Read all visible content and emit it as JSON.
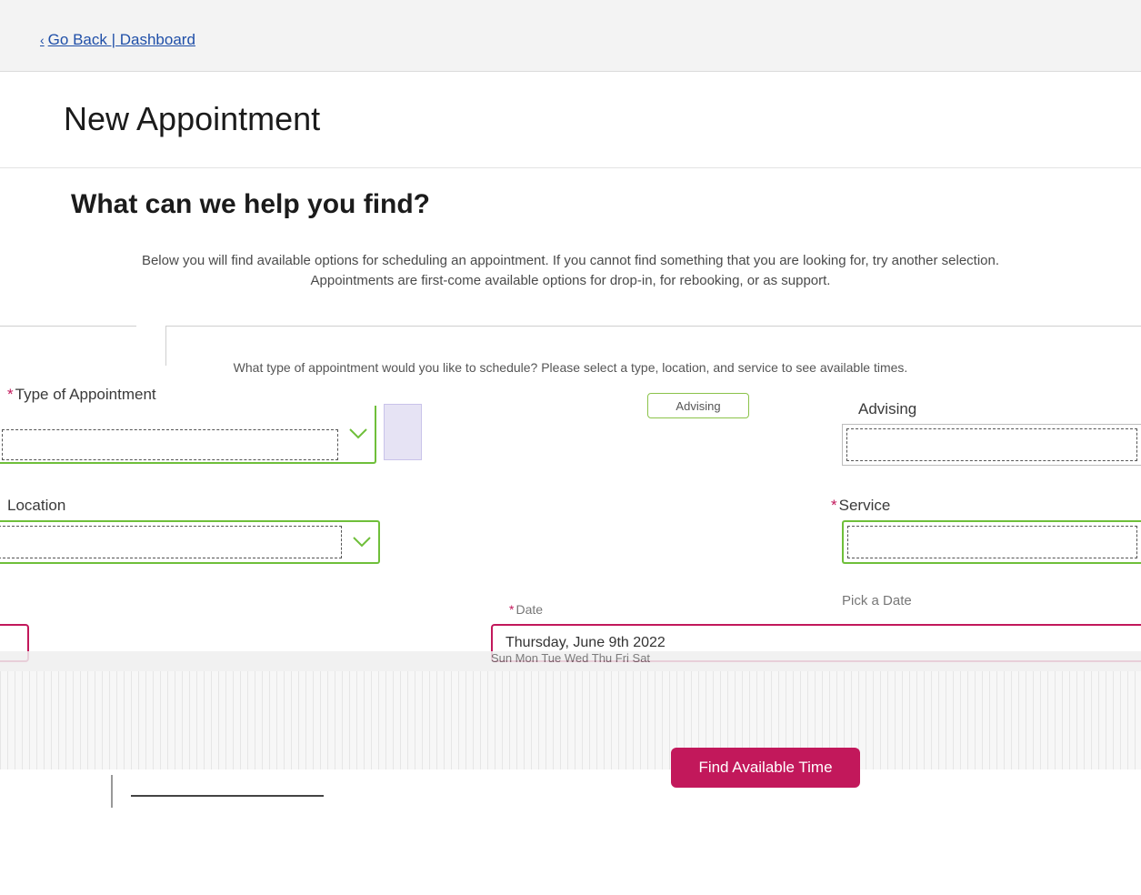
{
  "nav": {
    "back_link": "Go Back | Dashboard"
  },
  "page": {
    "title": "New Appointment"
  },
  "section": {
    "title": "What can we help you find?",
    "intro_line1": "Below you will find available options for scheduling an appointment. If you cannot find something that you are looking for, try another selection.",
    "intro_line2": "Appointments are first-come available options for drop-in, for rebooking, or as support."
  },
  "form": {
    "card_intro": "What type of appointment would you like to schedule? Please select a type, location, and service to see available times.",
    "chip_label": "Advising",
    "type_select": {
      "label": "Type of Appointment",
      "value": ""
    },
    "reason_field": {
      "label": "Advising",
      "value": ""
    },
    "location_select": {
      "label": "Location",
      "value": ""
    },
    "service_field": {
      "label": "Service",
      "value": ""
    },
    "date_field": {
      "label": "Date",
      "value": "Thursday, June 9th 2022",
      "pick_label": "Pick a Date"
    },
    "calendar_header": "Sun Mon Tue Wed Thu Fri Sat"
  },
  "actions": {
    "find_button": "Find Available Time"
  },
  "colors": {
    "accent": "#c2185b",
    "valid": "#6fbf3a",
    "link": "#1f4fa8"
  }
}
